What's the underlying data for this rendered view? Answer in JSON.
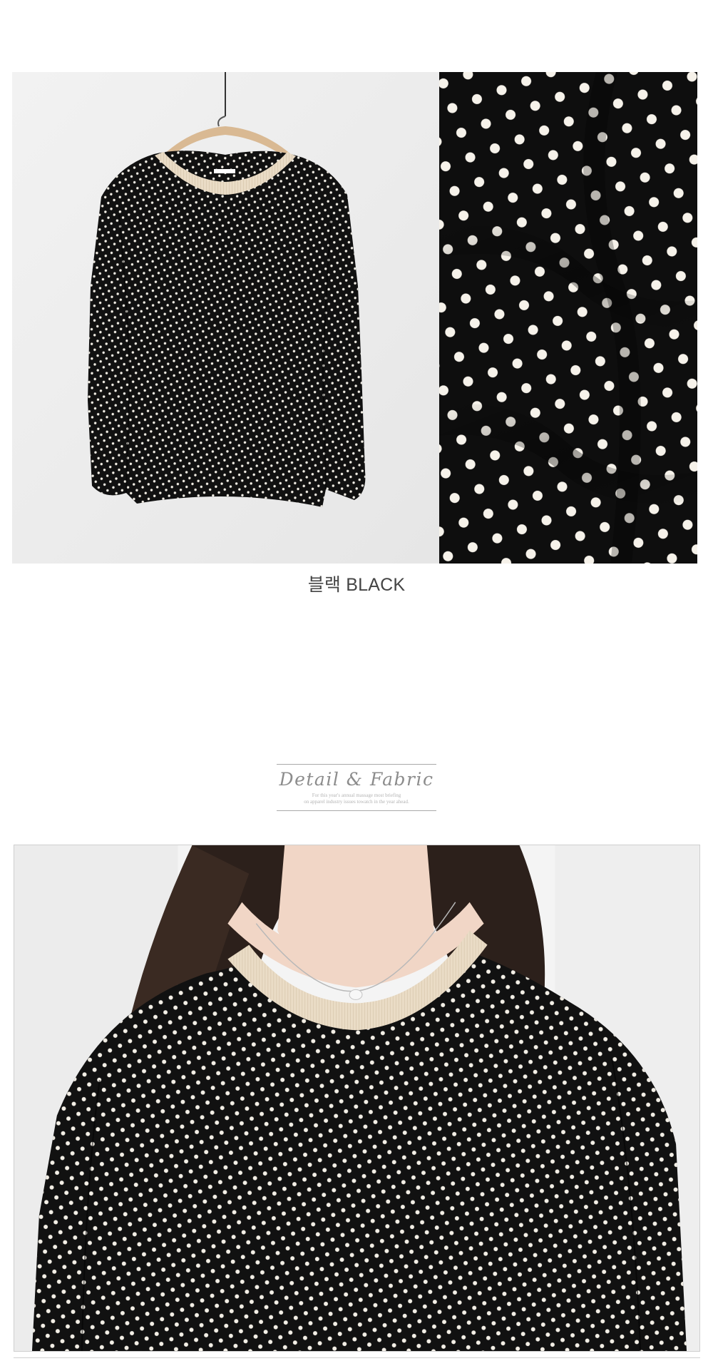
{
  "product": {
    "color_label": "블랙 BLACK",
    "images": {
      "flat_lay": "blouse-on-hanger-photo",
      "fabric": "polka-dot-fabric-closeup-photo",
      "model": "model-wearing-blouse-photo"
    }
  },
  "section": {
    "title": "Detail & Fabric",
    "subtitle_line1": "For this year's annual massage most briefing",
    "subtitle_line2": "on apparel industry issues towatch in the year ahead."
  },
  "colors": {
    "fabric": "#111111",
    "dots": "#f3efe6",
    "collar_rib": "#eadcc6",
    "background_wall": "#ebebeb",
    "hanger_wood": "#d9b993",
    "hair": "#2c201b",
    "skin": "#f1d6c6"
  }
}
